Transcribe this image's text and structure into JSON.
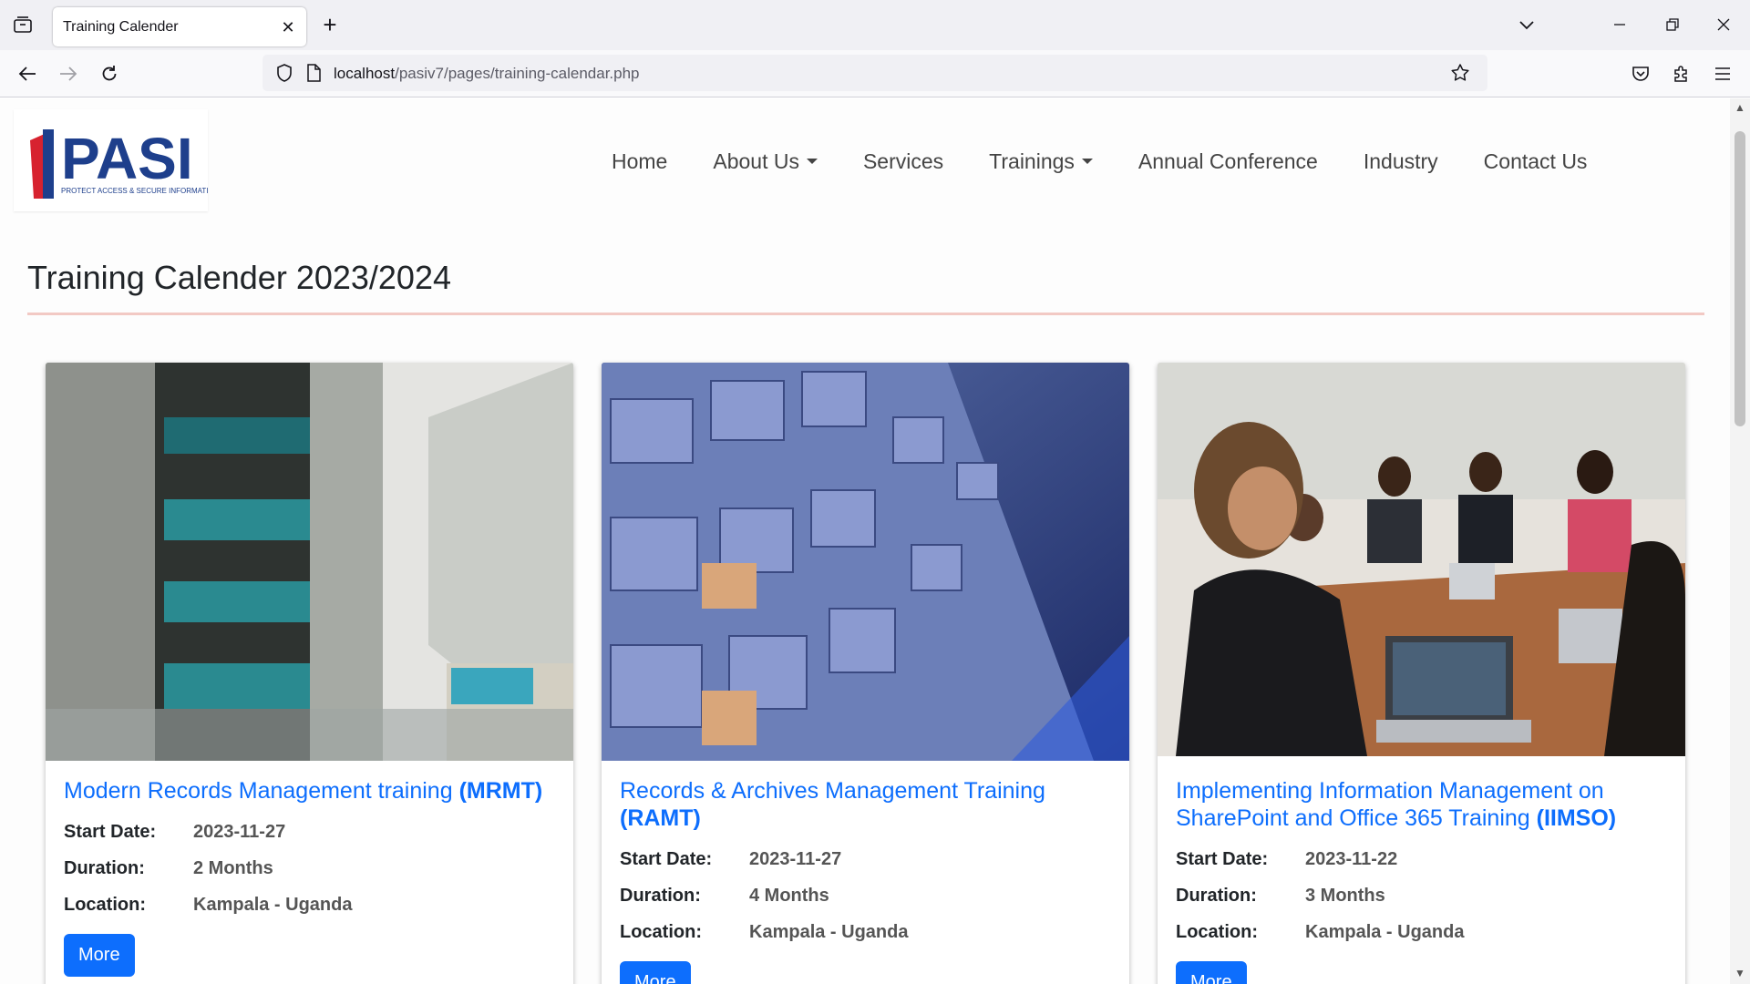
{
  "browser": {
    "tab_title": "Training Calender",
    "url_host": "localhost",
    "url_path": "/pasiv7/pages/training-calendar.php"
  },
  "site": {
    "logo_text": "PASI",
    "logo_tagline": "PROTECT ACCESS & SECURE INFORMATION",
    "nav": [
      {
        "label": "Home"
      },
      {
        "label": "About Us"
      },
      {
        "label": "Services"
      },
      {
        "label": "Trainings"
      },
      {
        "label": "Annual Conference"
      },
      {
        "label": "Industry"
      },
      {
        "label": "Contact Us"
      }
    ]
  },
  "page": {
    "title": "Training Calender 2023/2024"
  },
  "labels": {
    "start_date": "Start Date:",
    "duration": "Duration:",
    "location": "Location:",
    "more": "More"
  },
  "trainings": [
    {
      "title": "Modern Records Management training ",
      "code": "(MRMT)",
      "start_date": "2023-11-27",
      "duration": "2 Months",
      "location": "Kampala - Uganda"
    },
    {
      "title": "Records & Archives Management Training ",
      "code": "(RAMT)",
      "start_date": "2023-11-27",
      "duration": "4 Months",
      "location": "Kampala - Uganda"
    },
    {
      "title": "Implementing Information Management on SharePoint and Office 365 Training ",
      "code": "(IIMSO)",
      "start_date": "2023-11-22",
      "duration": "3 Months",
      "location": "Kampala - Uganda"
    }
  ],
  "colors": {
    "link_blue": "#0d6efd",
    "logo_blue": "#1e3f8c",
    "logo_red": "#d7222f",
    "rule_pink": "#f2c9c4"
  }
}
